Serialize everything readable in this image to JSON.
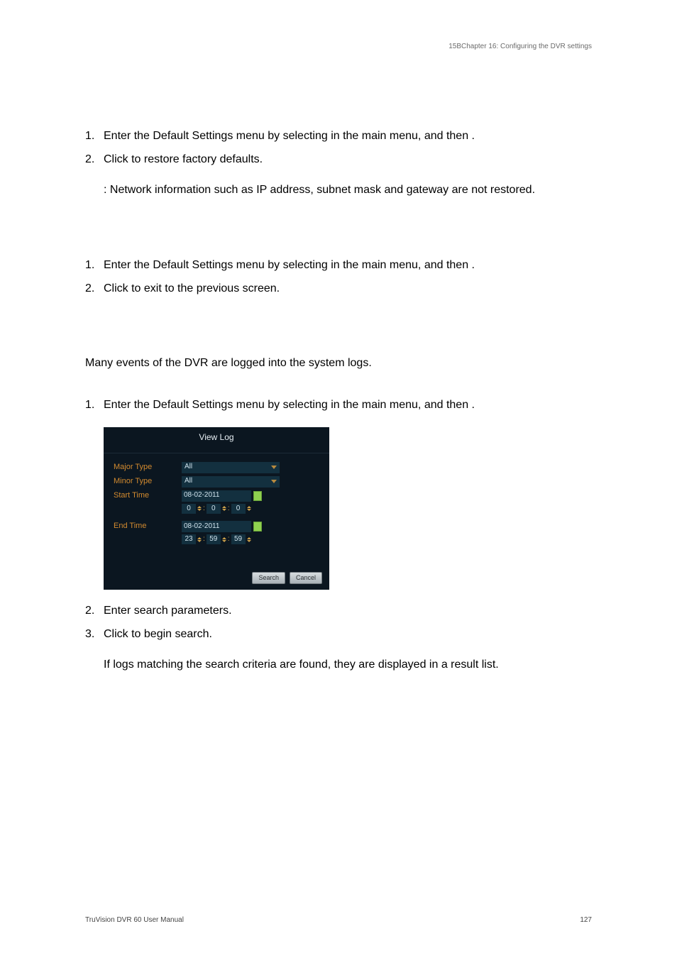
{
  "header": {
    "chapter": "15BChapter 16: Configuring the DVR settings"
  },
  "sec1": {
    "item1a": "Enter the Default Settings menu by selecting ",
    "item1b": " in the main menu, and then ",
    "item1c": ".",
    "item2a": "Click ",
    "item2b": " to restore factory defaults.",
    "note_a": ": Network information such as IP address, subnet mask and gateway are not restored."
  },
  "sec2": {
    "item1a": "Enter the Default Settings menu by selecting ",
    "item1b": " in the main menu, and then ",
    "item1c": ".",
    "item2a": "Click ",
    "item2b": " to exit to the previous screen."
  },
  "sec3": {
    "intro": "Many events of the DVR are logged into the system logs.",
    "item1a": "Enter the Default Settings menu by selecting ",
    "item1b": " in the main menu, and then ",
    "item1c": ".",
    "item2": "Enter search parameters.",
    "item3a": "Click ",
    "item3b": " to begin search.",
    "after": "If logs matching the search criteria are found, they are displayed in a result list."
  },
  "shot": {
    "title": "View Log",
    "label_major": "Major Type",
    "label_minor": "Minor Type",
    "label_start": "Start Time",
    "label_end": "End Time",
    "dd_all": "All",
    "start_date": "08-02-2011",
    "start_h": "0",
    "start_m": "0",
    "start_s": "0",
    "end_date": "08-02-2011",
    "end_h": "23",
    "end_m": "59",
    "end_s": "59",
    "btn_search": "Search",
    "btn_cancel": "Cancel"
  },
  "footer": {
    "left": "TruVision DVR 60 User Manual",
    "right": "127"
  }
}
